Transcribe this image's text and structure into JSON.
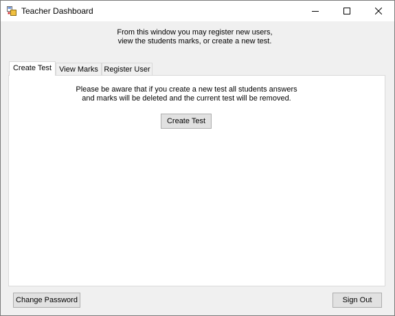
{
  "window": {
    "title": "Teacher Dashboard"
  },
  "intro": {
    "line1": "From this window you may register new users,",
    "line2": "view the students marks, or create a new test."
  },
  "tabs": [
    {
      "label": "Create Test",
      "active": true
    },
    {
      "label": "View Marks",
      "active": false
    },
    {
      "label": "Register User",
      "active": false
    }
  ],
  "create_panel": {
    "warning_line1": "Please be aware that if you create a new test all students answers",
    "warning_line2": "and marks will be deleted and the current test will be removed.",
    "create_button": "Create Test"
  },
  "footer": {
    "change_password": "Change Password",
    "sign_out": "Sign Out"
  }
}
